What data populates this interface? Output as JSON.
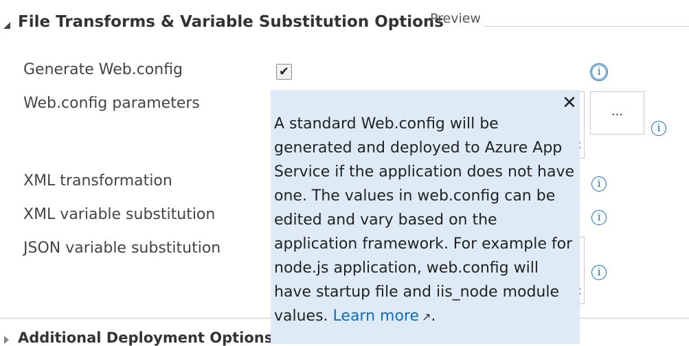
{
  "section": {
    "title": "File Transforms & Variable Substitution Options",
    "preview_label": "Preview"
  },
  "rows": {
    "generate_webconfig": "Generate Web.config",
    "webconfig_params": "Web.config parameters",
    "xml_transform": "XML transformation",
    "xml_var_sub": "XML variable substitution",
    "json_var_sub": "JSON variable substitution"
  },
  "controls": {
    "generate_checked_glyph": "✔",
    "ellipsis_label": "...",
    "info_glyph": "i",
    "edge_glyph": ";"
  },
  "tooltip": {
    "close_glyph": "✕",
    "text": "A standard Web.config will be generated and deployed to Azure App Service if the application does not have one. The values in web.config can be edited and vary based on the application framework. For example for node.js application, web.config will have startup file and iis_node module values.",
    "learn_more": "Learn more",
    "external_glyph": "↗",
    "trailing": "."
  },
  "next_section": {
    "title": "Additional Deployment Options"
  },
  "colors": {
    "tooltip_bg": "#deebf7",
    "accent": "#0f6cbd"
  }
}
